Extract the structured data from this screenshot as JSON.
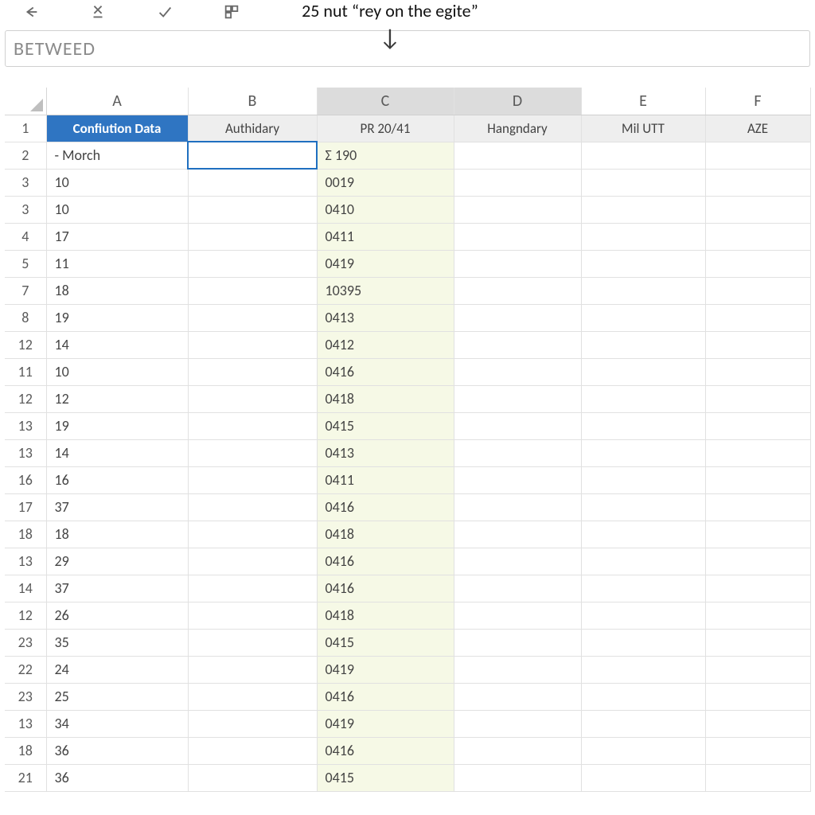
{
  "annotation": {
    "text": "25 nut “rey on the egite”",
    "arrow": "↓"
  },
  "toolbar_icons": {
    "back": "back-arrow-icon",
    "close": "x-underline-icon",
    "check": "checkmark-icon",
    "grid": "grid-icon"
  },
  "formula_bar": {
    "value": "BETWEED"
  },
  "column_letters": [
    "A",
    "B",
    "C",
    "D",
    "E",
    "F"
  ],
  "selected_columns": [
    "C",
    "D"
  ],
  "active_cell": "B2",
  "field_headers": {
    "A": "Confiution Data",
    "B": "Authidary",
    "C": "PR 20/41",
    "D": "Hangndary",
    "E": "Mil UTT",
    "F": "AZE"
  },
  "rows": [
    {
      "num": "2",
      "A": "- Morch",
      "C": "Σ 190"
    },
    {
      "num": "3",
      "A": "10",
      "C": "0019"
    },
    {
      "num": "3",
      "A": "10",
      "C": "0410"
    },
    {
      "num": "4",
      "A": "17",
      "C": "0411"
    },
    {
      "num": "5",
      "A": "11",
      "C": "0419"
    },
    {
      "num": "7",
      "A": "18",
      "C": "10395"
    },
    {
      "num": "8",
      "A": "19",
      "C": "0413"
    },
    {
      "num": "12",
      "A": "14",
      "C": "0412"
    },
    {
      "num": "11",
      "A": "10",
      "C": "0416"
    },
    {
      "num": "12",
      "A": "12",
      "C": "0418"
    },
    {
      "num": "13",
      "A": "19",
      "C": "0415"
    },
    {
      "num": "13",
      "A": "14",
      "C": "0413"
    },
    {
      "num": "16",
      "A": "16",
      "C": "0411"
    },
    {
      "num": "17",
      "A": "37",
      "C": "0416"
    },
    {
      "num": "18",
      "A": "18",
      "C": "0418"
    },
    {
      "num": "13",
      "A": "29",
      "C": "0416"
    },
    {
      "num": "14",
      "A": "37",
      "C": "0416"
    },
    {
      "num": "12",
      "A": "26",
      "C": "0418"
    },
    {
      "num": "23",
      "A": "35",
      "C": "0415"
    },
    {
      "num": "22",
      "A": "24",
      "C": "0419"
    },
    {
      "num": "23",
      "A": "25",
      "C": "0416"
    },
    {
      "num": "13",
      "A": "34",
      "C": "0419"
    },
    {
      "num": "18",
      "A": "36",
      "C": "0416"
    },
    {
      "num": "21",
      "A": "36",
      "C": "0415"
    }
  ],
  "chart_data": {
    "type": "table",
    "columns": [
      "A",
      "B",
      "C",
      "D",
      "E",
      "F"
    ],
    "column_headers": [
      "Confiution Data",
      "Authidary",
      "PR 20/41",
      "Hangndary",
      "Mil UTT",
      "AZE"
    ],
    "records": [
      [
        "- Morch",
        "",
        "Σ 190",
        "",
        "",
        ""
      ],
      [
        "10",
        "",
        "0019",
        "",
        "",
        ""
      ],
      [
        "10",
        "",
        "0410",
        "",
        "",
        ""
      ],
      [
        "17",
        "",
        "0411",
        "",
        "",
        ""
      ],
      [
        "11",
        "",
        "0419",
        "",
        "",
        ""
      ],
      [
        "18",
        "",
        "10395",
        "",
        "",
        ""
      ],
      [
        "19",
        "",
        "0413",
        "",
        "",
        ""
      ],
      [
        "14",
        "",
        "0412",
        "",
        "",
        ""
      ],
      [
        "10",
        "",
        "0416",
        "",
        "",
        ""
      ],
      [
        "12",
        "",
        "0418",
        "",
        "",
        ""
      ],
      [
        "19",
        "",
        "0415",
        "",
        "",
        ""
      ],
      [
        "14",
        "",
        "0413",
        "",
        "",
        ""
      ],
      [
        "16",
        "",
        "0411",
        "",
        "",
        ""
      ],
      [
        "37",
        "",
        "0416",
        "",
        "",
        ""
      ],
      [
        "18",
        "",
        "0418",
        "",
        "",
        ""
      ],
      [
        "29",
        "",
        "0416",
        "",
        "",
        ""
      ],
      [
        "37",
        "",
        "0416",
        "",
        "",
        ""
      ],
      [
        "26",
        "",
        "0418",
        "",
        "",
        ""
      ],
      [
        "35",
        "",
        "0415",
        "",
        "",
        ""
      ],
      [
        "24",
        "",
        "0419",
        "",
        "",
        ""
      ],
      [
        "25",
        "",
        "0416",
        "",
        "",
        ""
      ],
      [
        "34",
        "",
        "0419",
        "",
        "",
        ""
      ],
      [
        "36",
        "",
        "0416",
        "",
        "",
        ""
      ],
      [
        "36",
        "",
        "0415",
        "",
        "",
        ""
      ]
    ]
  }
}
